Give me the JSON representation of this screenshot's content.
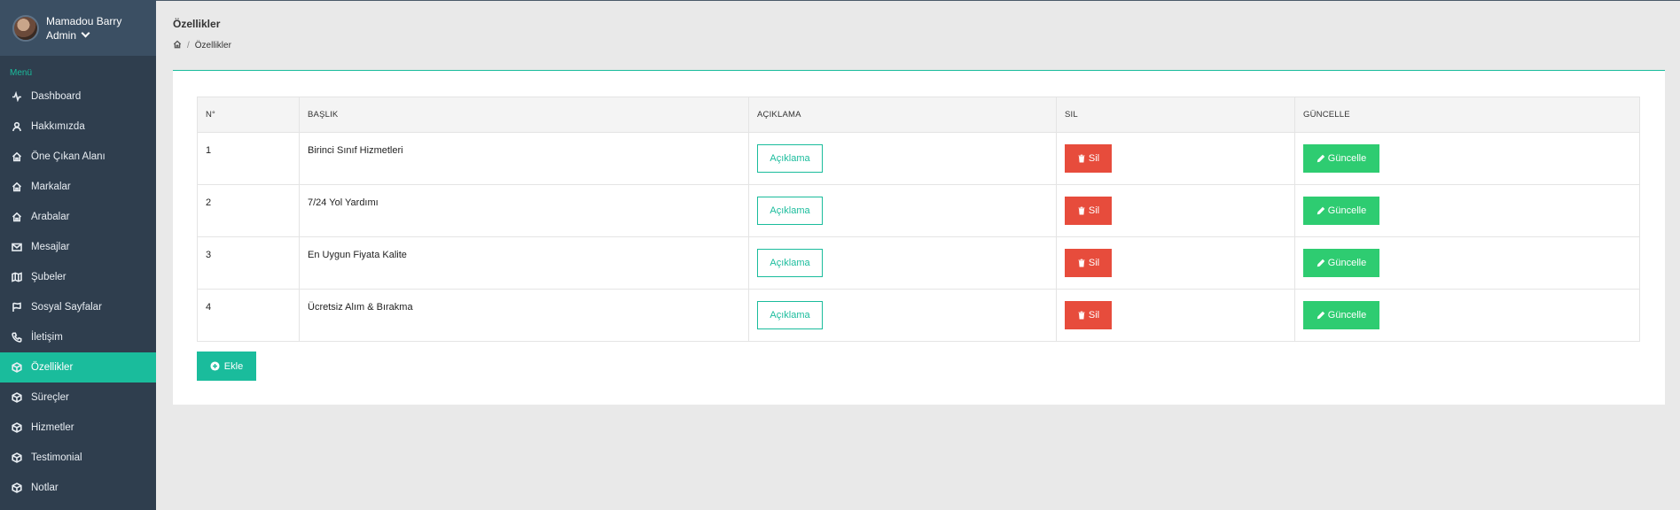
{
  "user": {
    "name": "Mamadou Barry",
    "role": "Admin"
  },
  "sidebar": {
    "menu_title": "Menü",
    "items": [
      {
        "label": "Dashboard",
        "icon": "activity-icon"
      },
      {
        "label": "Hakkımızda",
        "icon": "user-icon"
      },
      {
        "label": "Öne Çıkan Alanı",
        "icon": "home-icon"
      },
      {
        "label": "Markalar",
        "icon": "home-icon"
      },
      {
        "label": "Arabalar",
        "icon": "home-icon"
      },
      {
        "label": "Mesajlar",
        "icon": "mail-icon"
      },
      {
        "label": "Şubeler",
        "icon": "map-icon"
      },
      {
        "label": "Sosyal Sayfalar",
        "icon": "flag-icon"
      },
      {
        "label": "İletişim",
        "icon": "phone-icon"
      },
      {
        "label": "Özellikler",
        "icon": "box-icon",
        "active": true
      },
      {
        "label": "Süreçler",
        "icon": "box-icon"
      },
      {
        "label": "Hizmetler",
        "icon": "box-icon"
      },
      {
        "label": "Testimonial",
        "icon": "box-icon"
      },
      {
        "label": "Notlar",
        "icon": "box-icon"
      }
    ]
  },
  "page": {
    "title": "Özellikler",
    "breadcrumb": [
      "Özellikler"
    ]
  },
  "table": {
    "headers": [
      "N°",
      "BAŞLIK",
      "AÇIKLAMA",
      "SIL",
      "GÜNCELLE"
    ],
    "rows": [
      {
        "no": "1",
        "title": "Birinci Sınıf Hizmetleri"
      },
      {
        "no": "2",
        "title": "7/24 Yol Yardımı"
      },
      {
        "no": "3",
        "title": "En Uygun Fiyata Kalite"
      },
      {
        "no": "4",
        "title": "Ücretsiz Alım & Bırakma"
      }
    ],
    "desc_label": "Açıklama",
    "delete_label": "Sil",
    "update_label": "Güncelle"
  },
  "add_label": "Ekle",
  "colors": {
    "accent": "#1abc9c",
    "danger": "#e74c3c",
    "success": "#2ecc71",
    "sidebar": "#2f3e4e"
  }
}
